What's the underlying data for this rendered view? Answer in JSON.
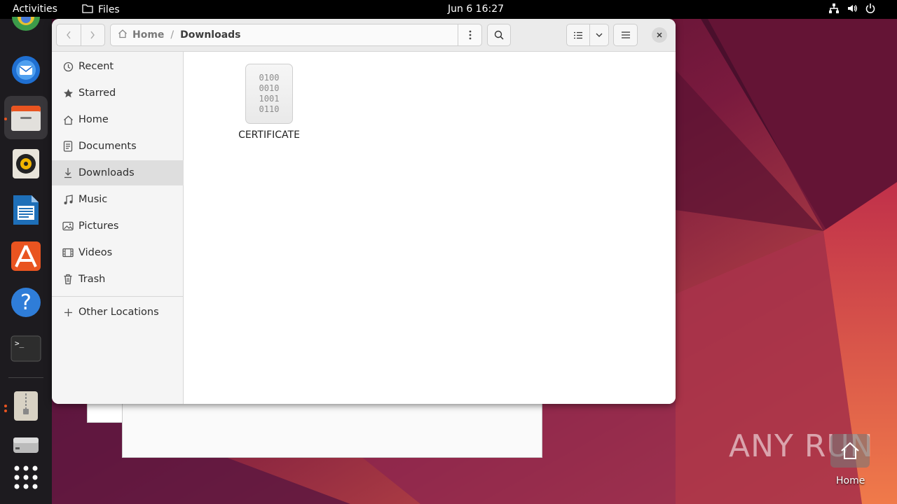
{
  "topbar": {
    "activities": "Activities",
    "app_name": "Files",
    "clock": "Jun 6  16:27",
    "status_icons": [
      "network-icon",
      "volume-icon",
      "power-icon"
    ]
  },
  "dock": {
    "apps": [
      "chrome-icon",
      "thunderbird-icon",
      "files-icon",
      "rhythmbox-icon",
      "libreoffice-writer-icon",
      "app-center-icon",
      "help-icon",
      "terminal-icon",
      "archive-icon",
      "disk-icon",
      "show-apps-icon"
    ],
    "active": "files-icon"
  },
  "window": {
    "pathbar": {
      "home": "Home",
      "separator": "/",
      "current": "Downloads"
    }
  },
  "sidebar": {
    "items": [
      {
        "label": "Recent",
        "icon": "clock-icon"
      },
      {
        "label": "Starred",
        "icon": "star-icon"
      },
      {
        "label": "Home",
        "icon": "home-icon"
      },
      {
        "label": "Documents",
        "icon": "document-icon"
      },
      {
        "label": "Downloads",
        "icon": "download-icon",
        "selected": true
      },
      {
        "label": "Music",
        "icon": "music-icon"
      },
      {
        "label": "Pictures",
        "icon": "picture-icon"
      },
      {
        "label": "Videos",
        "icon": "video-icon"
      },
      {
        "label": "Trash",
        "icon": "trash-icon"
      }
    ],
    "other_locations": "Other Locations"
  },
  "content": {
    "files": [
      {
        "name": "CERTIFICATE",
        "icon": "binary-file-icon",
        "icon_text": "0100\n0010\n1001\n0110"
      }
    ]
  },
  "desktop": {
    "watermark": "ANY RUN",
    "home_icon_label": "Home"
  },
  "colors": {
    "accent": "#e95420",
    "topbar": "#000000",
    "dock": "#1d1b1f"
  }
}
